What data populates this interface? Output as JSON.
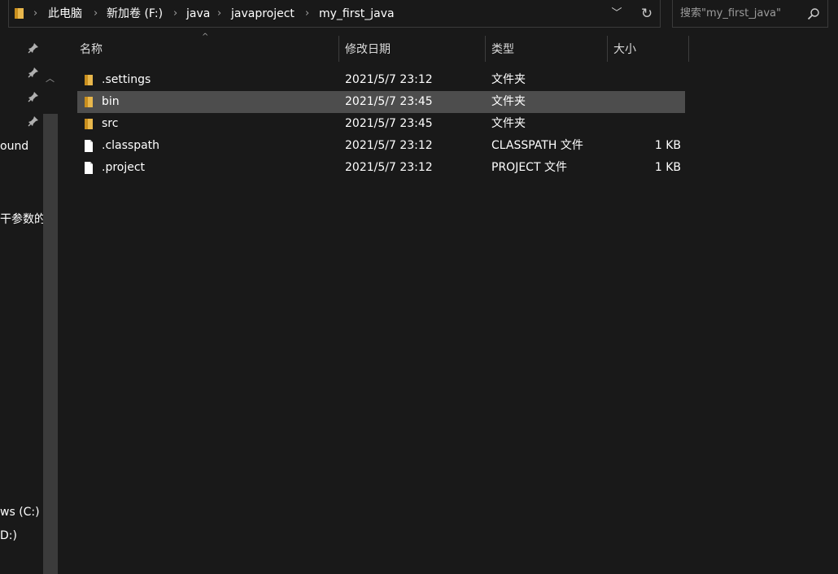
{
  "address_bar": {
    "breadcrumbs": [
      "此电脑",
      "新加卷 (F:)",
      "java",
      "javaproject",
      "my_first_java"
    ]
  },
  "search": {
    "placeholder": "搜索\"my_first_java\""
  },
  "nav_pane": {
    "partial_items": [
      "ound",
      "干参数的J",
      "ws (C:)",
      "D:)"
    ]
  },
  "columns": {
    "name": "名称",
    "date": "修改日期",
    "type": "类型",
    "size": "大小"
  },
  "files": [
    {
      "name": ".settings",
      "date": "2021/5/7 23:12",
      "type": "文件夹",
      "size": "",
      "icon": "folder",
      "selected": false
    },
    {
      "name": "bin",
      "date": "2021/5/7 23:45",
      "type": "文件夹",
      "size": "",
      "icon": "folder",
      "selected": true
    },
    {
      "name": "src",
      "date": "2021/5/7 23:45",
      "type": "文件夹",
      "size": "",
      "icon": "folder",
      "selected": false
    },
    {
      "name": ".classpath",
      "date": "2021/5/7 23:12",
      "type": "CLASSPATH 文件",
      "size": "1 KB",
      "icon": "file",
      "selected": false
    },
    {
      "name": ".project",
      "date": "2021/5/7 23:12",
      "type": "PROJECT 文件",
      "size": "1 KB",
      "icon": "file",
      "selected": false
    }
  ],
  "colors": {
    "background": "#191919",
    "selection": "#4d4d4d",
    "folder": "#e8b74c",
    "text": "#ffffff",
    "muted_text": "#9b9b9b"
  }
}
